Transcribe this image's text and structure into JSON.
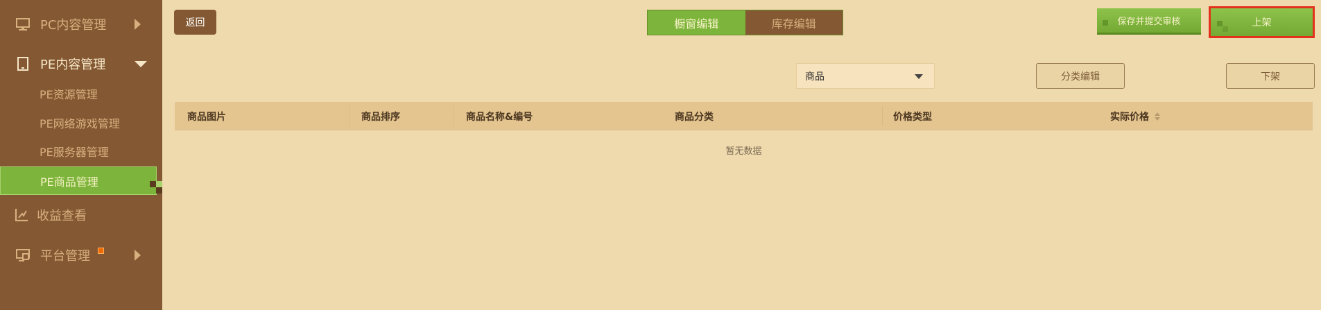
{
  "sidebar": {
    "items": [
      {
        "label": "PC内容管理",
        "icon": "monitor-icon"
      },
      {
        "label": "PE内容管理",
        "icon": "tablet-icon"
      },
      {
        "label": "PE资源管理"
      },
      {
        "label": "PE网络游戏管理"
      },
      {
        "label": "PE服务器管理"
      },
      {
        "label": "PE商品管理"
      },
      {
        "label": "收益查看",
        "icon": "chart-icon"
      },
      {
        "label": "平台管理",
        "icon": "platform-icon"
      }
    ]
  },
  "toolbar": {
    "back_label": "返回",
    "tabs": [
      "橱窗编辑",
      "库存编辑"
    ],
    "active_tab": "橱窗编辑",
    "save_submit_label": "保存并提交审核",
    "publish_label": "上架"
  },
  "filter": {
    "select_value": "商品",
    "category_edit_label": "分类编辑",
    "unpublish_label": "下架"
  },
  "table": {
    "columns": [
      "商品图片",
      "商品排序",
      "商品名称&编号",
      "商品分类",
      "价格类型",
      "实际价格"
    ],
    "empty_text": "暂无数据"
  },
  "colors": {
    "sidebar_bg": "#845833",
    "page_bg": "#efdaae",
    "accent_green": "#7db43b",
    "highlight_red": "#e3321c",
    "badge_orange": "#f06a00"
  }
}
